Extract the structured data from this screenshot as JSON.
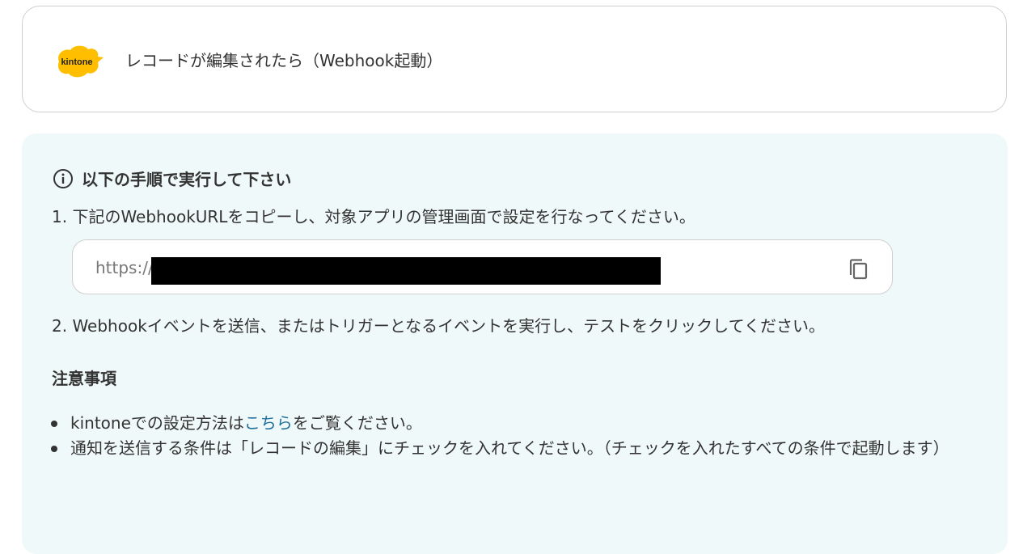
{
  "trigger": {
    "logo_text": "kintone",
    "title": "レコードが編集されたら（Webhook起動）"
  },
  "instructions": {
    "heading": "以下の手順で実行して下さい",
    "step1": "1. 下記のWebhookURLをコピーし、対象アプリの管理画面で設定を行なってください。",
    "url_prefix": "https://",
    "step2": "2. Webhookイベントを送信、またはトリガーとなるイベントを実行し、テストをクリックしてください。"
  },
  "notes": {
    "title": "注意事項",
    "item1_before": "kintoneでの設定方法は",
    "item1_link": "こちら",
    "item1_after": "をご覧ください。",
    "item2": "通知を送信する条件は「レコードの編集」にチェックを入れてください。（チェックを入れたすべての条件で起動します）"
  },
  "colors": {
    "panel_bg": "#f0f9f9",
    "logo_yellow": "#ffbe00",
    "link": "#1f6f9a"
  }
}
